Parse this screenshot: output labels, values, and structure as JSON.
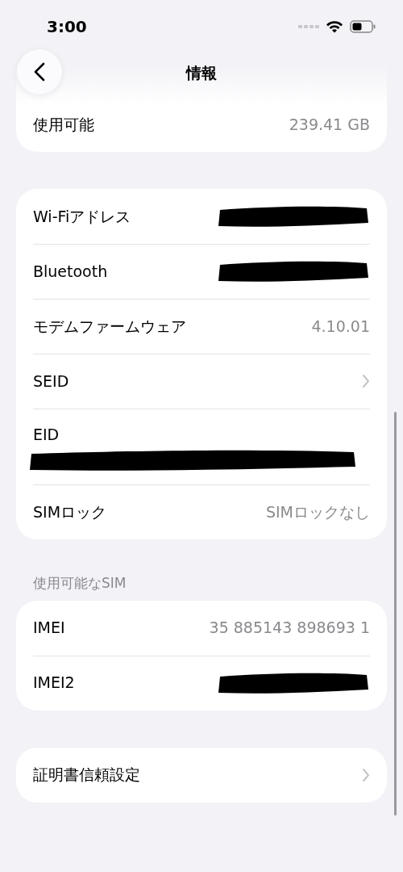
{
  "status_bar": {
    "time": "3:00"
  },
  "nav": {
    "title": "情報"
  },
  "groups": [
    {
      "rows": [
        {
          "kind": "value",
          "label": "使用可能",
          "value": "239.41 GB"
        }
      ],
      "cut_top": true
    },
    {
      "rows": [
        {
          "kind": "redacted",
          "label": "Wi-Fiアドレス"
        },
        {
          "kind": "redacted",
          "label": "Bluetooth"
        },
        {
          "kind": "value",
          "label": "モデムファームウェア",
          "value": "4.10.01"
        },
        {
          "kind": "link",
          "label": "SEID"
        },
        {
          "kind": "redacted_below",
          "label": "EID"
        },
        {
          "kind": "value",
          "label": "SIMロック",
          "value": "SIMロックなし"
        }
      ]
    },
    {
      "header": "使用可能なSIM",
      "rows": [
        {
          "kind": "value",
          "label": "IMEI",
          "value": "35 885143 898693 1"
        },
        {
          "kind": "redacted",
          "label": "IMEI2"
        }
      ]
    },
    {
      "rows": [
        {
          "kind": "link",
          "label": "証明書信頼設定"
        }
      ]
    }
  ]
}
